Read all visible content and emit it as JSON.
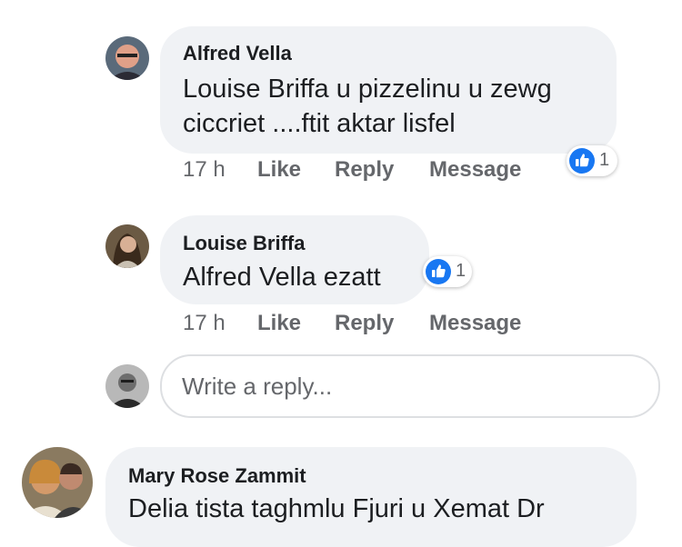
{
  "comments": [
    {
      "author": "Alfred Vella",
      "lines": [
        "Louise Briffa u pizzelinu u zewg",
        "ciccriet ....ftit aktar lisfel"
      ],
      "time": "17 h",
      "like": "Like",
      "reply": "Reply",
      "message": "Message",
      "reaction_count": "1"
    },
    {
      "author": "Louise Briffa",
      "lines": [
        "Alfred Vella ezatt"
      ],
      "time": "17 h",
      "like": "Like",
      "reply": "Reply",
      "message": "Message",
      "reaction_count": "1"
    }
  ],
  "reply_box": {
    "placeholder": "Write a reply..."
  },
  "next_comment": {
    "author": "Mary Rose Zammit",
    "lines": [
      "Delia tista taghmlu Fjuri u Xemat Dr"
    ]
  },
  "colors": {
    "bubble": "#f0f2f5",
    "like_blue": "#1877f2",
    "meta_gray": "#65676b"
  }
}
